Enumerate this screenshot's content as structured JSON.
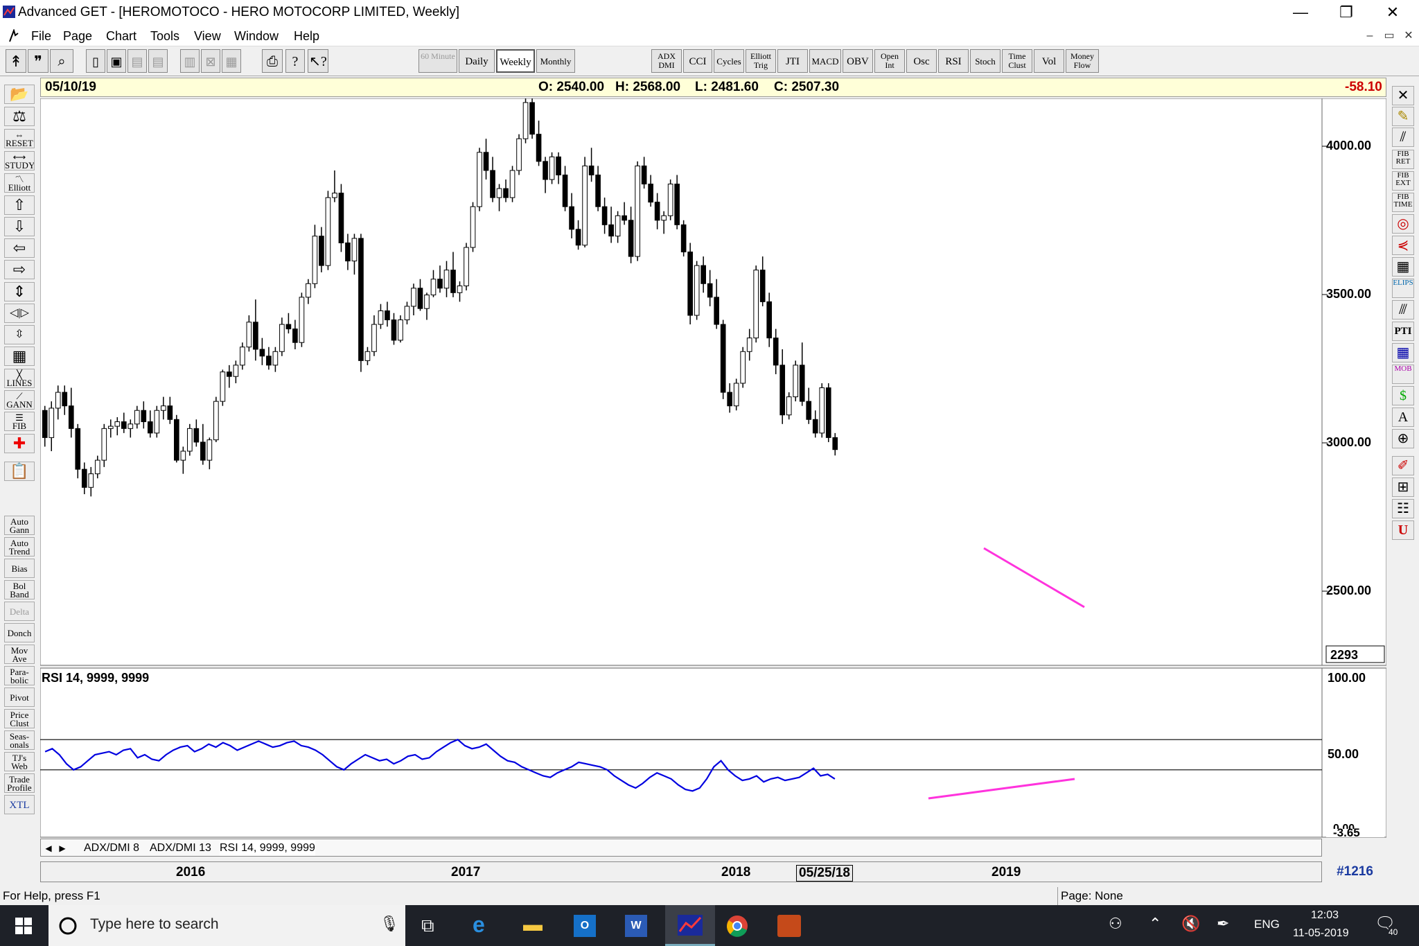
{
  "window": {
    "title": "Advanced GET - [HEROMOTOCO - HERO MOTOCORP LIMITED, Weekly]",
    "min": "—",
    "max": "❐",
    "close": "✕"
  },
  "menu": [
    "File",
    "Page",
    "Chart",
    "Tools",
    "View",
    "Window",
    "Help"
  ],
  "toolbar": {
    "timeframes": [
      "60 Minute",
      "Daily",
      "Weekly",
      "Monthly"
    ],
    "studies": [
      "ADX DMI",
      "CCI",
      "Cycles",
      "Elliott Trig",
      "JTI",
      "MACD",
      "OBV",
      "Open Int",
      "Osc",
      "RSI",
      "Stoch",
      "Time Clust",
      "Vol",
      "Money Flow"
    ]
  },
  "left_tools": [
    "Auto Gann",
    "Auto Trend",
    "Bias",
    "Bol Band",
    "Delta",
    "Donch",
    "Mov Ave",
    "Para-bolic",
    "Pivot",
    "Price Clust",
    "Seas-onals",
    "TJ's Web",
    "Trade Profile",
    "XTL"
  ],
  "left_icons": [
    "RESET",
    "STUDY",
    "Elliott",
    "LINES",
    "GANN",
    "FIB"
  ],
  "right_tools": [
    "FIB RET",
    "FIB EXT",
    "FIB TIME",
    "ELIPS",
    "PTI",
    "MOB"
  ],
  "info": {
    "date": "05/10/19",
    "open": "O: 2540.00",
    "high": "H: 2568.00",
    "low": "L: 2481.60",
    "close": "C: 2507.30",
    "change": "-58.10"
  },
  "price_axis": {
    "ticks": [
      "4000.00",
      "3500.00",
      "3000.00",
      "2500.00"
    ],
    "last": "2293"
  },
  "rsi_panel": {
    "label": "RSI 14, 9999, 9999",
    "ticks": [
      "100.00",
      "50.00"
    ],
    "last": "-3.65",
    "bottom_tick": "0.00"
  },
  "tabs": [
    "ADX/DMI 8",
    "ADX/DMI 13",
    "RSI 14, 9999, 9999"
  ],
  "date_axis": {
    "years": [
      "2016",
      "2017",
      "2018",
      "2019"
    ],
    "cursor_date": "05/25/18",
    "bar_count": "#1216"
  },
  "status": {
    "help": "For Help, press F1",
    "page": "Page: None"
  },
  "taskbar": {
    "search": "Type here to search",
    "lang": "ENG",
    "time": "12:03",
    "date": "11-05-2019",
    "notifications": "40"
  },
  "colors": {
    "candle": "#000000",
    "rsi_line": "#0000e0",
    "trendline": "#ff33dd",
    "info_bg": "#ffffd8",
    "change": "#cc0000"
  },
  "chart_data": {
    "type": "candlestick",
    "symbol": "HEROMOTOCO",
    "timeframe": "Weekly",
    "ylim": [
      2293,
      4150
    ],
    "ohlc": [
      [
        2680,
        2700,
        2520,
        2560
      ],
      [
        2560,
        2720,
        2500,
        2690
      ],
      [
        2690,
        2790,
        2640,
        2760
      ],
      [
        2760,
        2790,
        2660,
        2700
      ],
      [
        2700,
        2780,
        2560,
        2600
      ],
      [
        2600,
        2620,
        2380,
        2420
      ],
      [
        2420,
        2450,
        2310,
        2340
      ],
      [
        2340,
        2430,
        2300,
        2400
      ],
      [
        2400,
        2480,
        2380,
        2460
      ],
      [
        2460,
        2620,
        2430,
        2600
      ],
      [
        2600,
        2640,
        2560,
        2610
      ],
      [
        2610,
        2650,
        2570,
        2630
      ],
      [
        2630,
        2670,
        2580,
        2600
      ],
      [
        2600,
        2640,
        2560,
        2620
      ],
      [
        2620,
        2700,
        2600,
        2680
      ],
      [
        2680,
        2720,
        2600,
        2630
      ],
      [
        2630,
        2680,
        2560,
        2580
      ],
      [
        2580,
        2700,
        2560,
        2680
      ],
      [
        2680,
        2740,
        2640,
        2700
      ],
      [
        2700,
        2740,
        2620,
        2640
      ],
      [
        2640,
        2660,
        2450,
        2460
      ],
      [
        2460,
        2520,
        2400,
        2500
      ],
      [
        2500,
        2620,
        2480,
        2600
      ],
      [
        2600,
        2640,
        2520,
        2540
      ],
      [
        2540,
        2620,
        2440,
        2460
      ],
      [
        2460,
        2560,
        2420,
        2550
      ],
      [
        2550,
        2740,
        2540,
        2720
      ],
      [
        2720,
        2860,
        2700,
        2850
      ],
      [
        2850,
        2880,
        2780,
        2830
      ],
      [
        2830,
        2900,
        2800,
        2880
      ],
      [
        2880,
        2980,
        2860,
        2960
      ],
      [
        2960,
        3100,
        2940,
        3070
      ],
      [
        3070,
        3170,
        2900,
        2950
      ],
      [
        2950,
        3000,
        2880,
        2920
      ],
      [
        2920,
        2960,
        2860,
        2880
      ],
      [
        2880,
        2960,
        2850,
        2940
      ],
      [
        2940,
        3090,
        2920,
        3060
      ],
      [
        3060,
        3110,
        3020,
        3040
      ],
      [
        3040,
        3080,
        2950,
        2980
      ],
      [
        2980,
        3200,
        2960,
        3180
      ],
      [
        3180,
        3260,
        3150,
        3240
      ],
      [
        3240,
        3500,
        3220,
        3450
      ],
      [
        3450,
        3490,
        3290,
        3320
      ],
      [
        3320,
        3650,
        3300,
        3620
      ],
      [
        3620,
        3740,
        3600,
        3640
      ],
      [
        3640,
        3680,
        3380,
        3420
      ],
      [
        3420,
        3460,
        3300,
        3340
      ],
      [
        3340,
        3460,
        3280,
        3440
      ],
      [
        3440,
        3460,
        2850,
        2900
      ],
      [
        2900,
        2960,
        2880,
        2940
      ],
      [
        2940,
        3100,
        2920,
        3060
      ],
      [
        3060,
        3150,
        3040,
        3120
      ],
      [
        3120,
        3160,
        3050,
        3080
      ],
      [
        3080,
        3110,
        2970,
        2990
      ],
      [
        2990,
        3100,
        2980,
        3080
      ],
      [
        3080,
        3160,
        3060,
        3140
      ],
      [
        3140,
        3240,
        3100,
        3220
      ],
      [
        3220,
        3260,
        3120,
        3130
      ],
      [
        3130,
        3200,
        3080,
        3190
      ],
      [
        3190,
        3300,
        3180,
        3260
      ],
      [
        3260,
        3320,
        3200,
        3220
      ],
      [
        3220,
        3340,
        3180,
        3300
      ],
      [
        3300,
        3380,
        3180,
        3200
      ],
      [
        3200,
        3250,
        3160,
        3230
      ],
      [
        3230,
        3420,
        3210,
        3400
      ],
      [
        3400,
        3600,
        3380,
        3580
      ],
      [
        3580,
        3840,
        3560,
        3820
      ],
      [
        3820,
        3880,
        3700,
        3740
      ],
      [
        3740,
        3800,
        3600,
        3620
      ],
      [
        3620,
        3680,
        3560,
        3660
      ],
      [
        3660,
        3700,
        3600,
        3620
      ],
      [
        3620,
        3760,
        3600,
        3740
      ],
      [
        3740,
        3900,
        3720,
        3880
      ],
      [
        3880,
        4080,
        3860,
        4040
      ],
      [
        4040,
        4100,
        3880,
        3900
      ],
      [
        3900,
        3960,
        3760,
        3780
      ],
      [
        3780,
        3800,
        3640,
        3700
      ],
      [
        3700,
        3820,
        3680,
        3800
      ],
      [
        3800,
        3820,
        3680,
        3720
      ],
      [
        3720,
        3760,
        3560,
        3580
      ],
      [
        3580,
        3640,
        3440,
        3480
      ],
      [
        3480,
        3520,
        3390,
        3410
      ],
      [
        3410,
        3800,
        3400,
        3760
      ],
      [
        3760,
        3840,
        3690,
        3720
      ],
      [
        3720,
        3760,
        3560,
        3580
      ],
      [
        3580,
        3620,
        3460,
        3500
      ],
      [
        3500,
        3580,
        3420,
        3450
      ],
      [
        3450,
        3560,
        3420,
        3540
      ],
      [
        3540,
        3600,
        3500,
        3520
      ],
      [
        3520,
        3580,
        3330,
        3360
      ],
      [
        3360,
        3780,
        3340,
        3760
      ],
      [
        3760,
        3800,
        3660,
        3680
      ],
      [
        3680,
        3720,
        3580,
        3600
      ],
      [
        3600,
        3640,
        3480,
        3520
      ],
      [
        3520,
        3560,
        3460,
        3540
      ],
      [
        3540,
        3700,
        3520,
        3680
      ],
      [
        3680,
        3720,
        3480,
        3500
      ],
      [
        3500,
        3520,
        3360,
        3380
      ],
      [
        3380,
        3420,
        3060,
        3100
      ],
      [
        3100,
        3340,
        3080,
        3320
      ],
      [
        3320,
        3360,
        3200,
        3240
      ],
      [
        3240,
        3300,
        3140,
        3180
      ],
      [
        3180,
        3260,
        3040,
        3060
      ],
      [
        3060,
        3080,
        2730,
        2760
      ],
      [
        2760,
        2800,
        2670,
        2700
      ],
      [
        2700,
        2820,
        2680,
        2800
      ],
      [
        2800,
        2960,
        2780,
        2940
      ],
      [
        2940,
        3040,
        2900,
        3000
      ],
      [
        3000,
        3320,
        2980,
        3300
      ],
      [
        3300,
        3360,
        3140,
        3160
      ],
      [
        3160,
        3200,
        2960,
        3000
      ],
      [
        3000,
        3040,
        2840,
        2880
      ],
      [
        2880,
        2950,
        2620,
        2660
      ],
      [
        2660,
        2760,
        2640,
        2740
      ],
      [
        2740,
        2900,
        2720,
        2880
      ],
      [
        2880,
        2980,
        2700,
        2720
      ],
      [
        2720,
        2780,
        2620,
        2640
      ],
      [
        2640,
        2680,
        2560,
        2580
      ],
      [
        2580,
        2800,
        2560,
        2780
      ],
      [
        2780,
        2800,
        2540,
        2560
      ],
      [
        2560,
        2580,
        2481,
        2507
      ]
    ],
    "rsi": [
      52,
      54,
      50,
      44,
      40,
      42,
      46,
      50,
      51,
      52,
      50,
      53,
      54,
      48,
      50,
      47,
      46,
      50,
      53,
      55,
      56,
      52,
      54,
      57,
      55,
      58,
      56,
      53,
      55,
      57,
      59,
      57,
      55,
      56,
      58,
      59,
      56,
      55,
      53,
      50,
      46,
      42,
      40,
      44,
      47,
      50,
      48,
      46,
      47,
      44,
      46,
      49,
      50,
      47,
      48,
      52,
      55,
      58,
      60,
      56,
      54,
      55,
      57,
      53,
      49,
      46,
      45,
      42,
      40,
      38,
      36,
      35,
      38,
      40,
      42,
      45,
      44,
      43,
      42,
      40,
      36,
      33,
      30,
      28,
      31,
      35,
      38,
      36,
      34,
      30,
      27,
      26,
      28,
      34,
      42,
      46,
      40,
      36,
      33,
      34,
      36,
      32,
      34,
      35,
      33,
      34,
      35,
      38,
      41,
      36,
      37,
      34
    ],
    "rsi_levels": [
      60,
      40
    ],
    "annotations": [
      "trendline-price-lower-lows",
      "trendline-rsi-higher-lows"
    ]
  }
}
